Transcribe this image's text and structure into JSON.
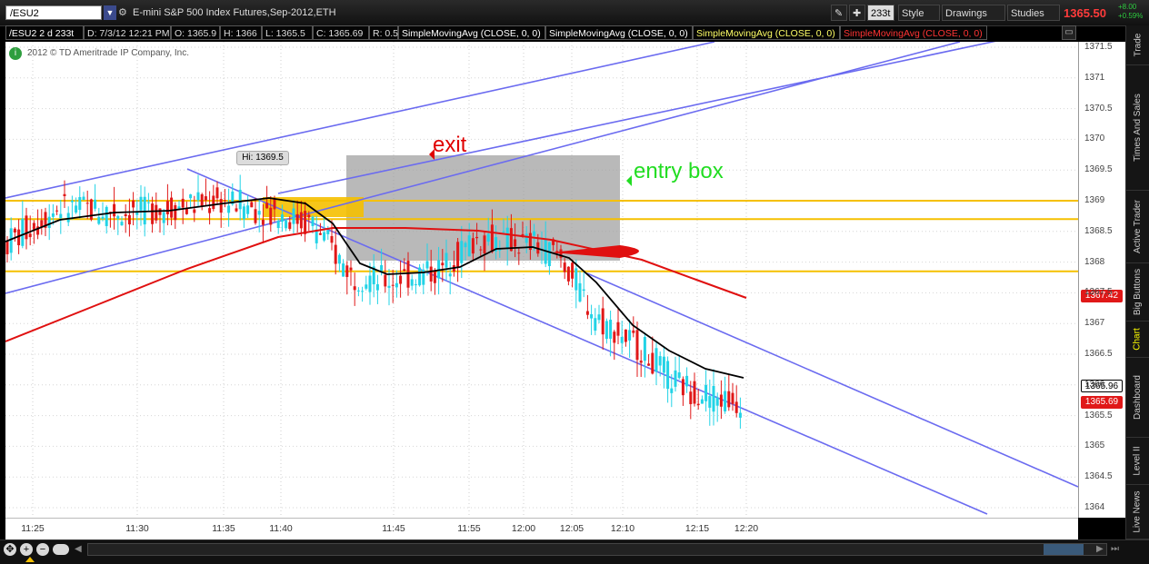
{
  "toolbar": {
    "symbol": "/ESU2",
    "description": "E-mini S&P 500 Index Futures,Sep-2012,ETH",
    "aggregation": "233t",
    "style_label": "Style",
    "drawings_label": "Drawings",
    "studies_label": "Studies",
    "last_price": "1365.50",
    "change": "+8.00",
    "change_pct": "+0.59%"
  },
  "info_row": {
    "symbol_period": "/ESU2 2 d 233t",
    "date": "D: 7/3/12 12:21 PM",
    "open": "O: 1365.9",
    "high": "H: 1366",
    "low": "L: 1365.5",
    "close": "C: 1365.69",
    "range": "R: 0.5",
    "studies": [
      {
        "label": "SimpleMovingAvg (CLOSE, 0, 0)",
        "color": "#ffffff"
      },
      {
        "label": "SimpleMovingAvg (CLOSE, 0, 0)",
        "color": "#ffffff"
      },
      {
        "label": "SimpleMovingAvg (CLOSE, 0, 0)",
        "color": "#ffff66"
      },
      {
        "label": "SimpleMovingAvg (CLOSE, 0, 0)",
        "color": "#ff3333"
      }
    ]
  },
  "copyright": "2012 © TD Ameritrade IP Company, Inc.",
  "annotations": {
    "hi_label": "Hi: 1369.5",
    "exit_label": "exit",
    "entry_label": "entry box"
  },
  "price_tags": {
    "ma_red": "1367.42",
    "ma_black": "1365.96",
    "last": "1365.69"
  },
  "sidebar": [
    "Trade",
    "Times And Sales",
    "Active Trader",
    "Big Buttons",
    "Chart",
    "Dashboard",
    "Level II",
    "Live News"
  ],
  "chart_data": {
    "type": "candlestick",
    "y_ticks": [
      "1371.5",
      "1371",
      "1370.5",
      "1370",
      "1369.5",
      "1369",
      "1368.5",
      "1368",
      "1367.5",
      "1367",
      "1366.5",
      "1366",
      "1365.5",
      "1365",
      "1364.5",
      "1364"
    ],
    "x_ticks": [
      "11:25",
      "11:30",
      "11:35",
      "11:40",
      "11:45",
      "11:55",
      "12:00",
      "12:05",
      "12:10",
      "12:15",
      "12:20"
    ],
    "ylim": [
      1363.9,
      1371.6
    ],
    "horizontal_levels": [
      1369.0,
      1368.7,
      1367.85
    ],
    "colors": {
      "up": "#22d3e6",
      "down": "#e01818",
      "ma_fast": "#000000",
      "ma_slow": "#e01010",
      "channel": "#6b6bf0",
      "level": "#f5c000",
      "entry_box": "#9e9e9e"
    }
  }
}
